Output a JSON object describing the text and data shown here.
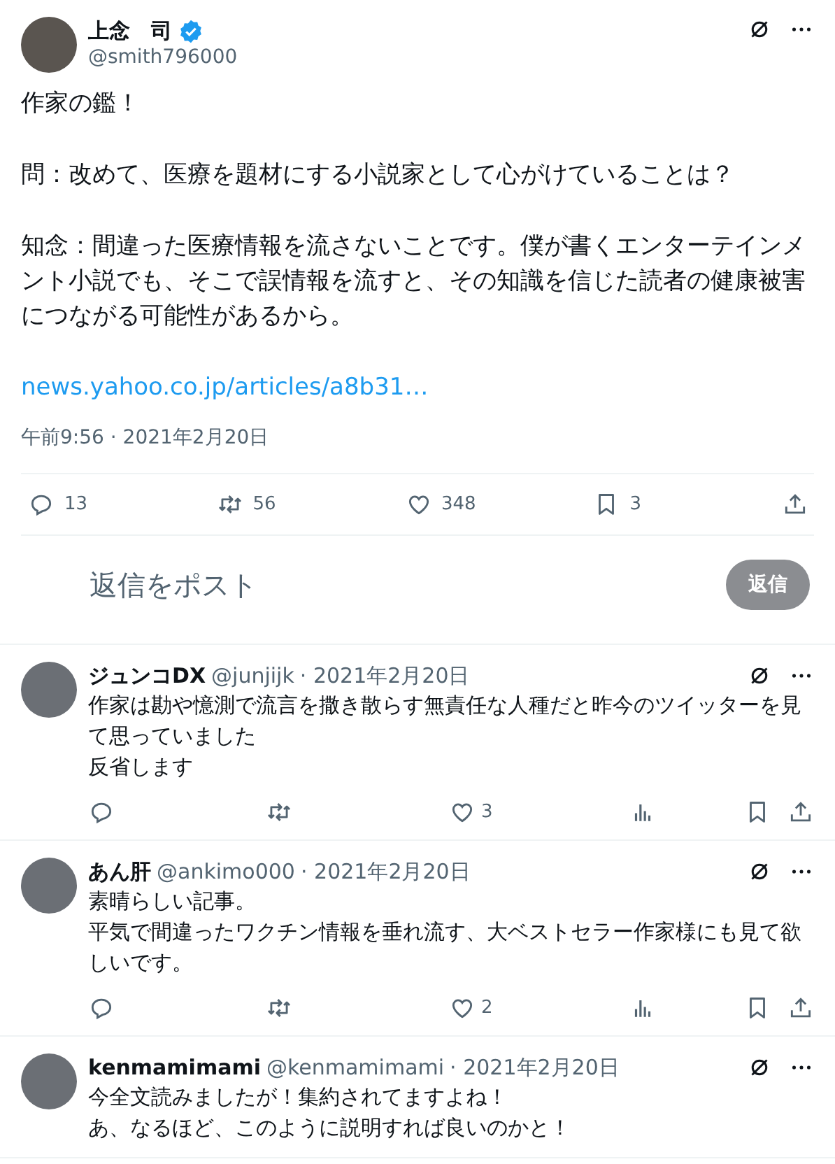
{
  "post": {
    "author": {
      "name": "上念　司",
      "handle": "@smith796000",
      "verified": true
    },
    "paragraphs": [
      "作家の鑑！",
      "問：改めて、医療を題材にする小説家として心がけていることは？",
      "知念：間違った医療情報を流さないことです。僕が書くエンターテインメント小説でも、そこで誤情報を流すと、その知識を信じた読者の健康被害につながる可能性があるから。"
    ],
    "link": "news.yahoo.co.jp/articles/a8b31…",
    "timestamp": "午前9:56 · 2021年2月20日",
    "stats": [
      {
        "kind": "reply",
        "count": "13"
      },
      {
        "kind": "repost",
        "count": "56"
      },
      {
        "kind": "like",
        "count": "348"
      },
      {
        "kind": "bookmark",
        "count": "3"
      },
      {
        "kind": "share"
      }
    ]
  },
  "reply_box": {
    "placeholder": "返信をポスト",
    "button": "返信"
  },
  "replies": [
    {
      "name": "ジュンコDX",
      "handle": "@junjijk",
      "date": "· 2021年2月20日",
      "lines": [
        "作家は勘や憶測で流言を撒き散らす無責任な人種だと昨今のツイッターを見て思っていました",
        "反省します"
      ],
      "actions": [
        {
          "kind": "reply"
        },
        {
          "kind": "repost"
        },
        {
          "kind": "like",
          "count": "3"
        },
        {
          "kind": "views"
        },
        {
          "kind": "bookmark"
        },
        {
          "kind": "share"
        }
      ]
    },
    {
      "name": "あん肝",
      "handle": "@ankimo000",
      "date": "· 2021年2月20日",
      "lines": [
        "素晴らしい記事。",
        "平気で間違ったワクチン情報を垂れ流す、大ベストセラー作家様にも見て欲しいです。"
      ],
      "actions": [
        {
          "kind": "reply"
        },
        {
          "kind": "repost"
        },
        {
          "kind": "like",
          "count": "2"
        },
        {
          "kind": "views"
        },
        {
          "kind": "bookmark"
        },
        {
          "kind": "share"
        }
      ]
    },
    {
      "name": "kenmamimami",
      "handle": "@kenmamimami",
      "date": "· 2021年2月20日",
      "lines": [
        "今全文読みましたが！集約されてますよね！",
        "あ、なるほど、このように説明すれば良いのかと！"
      ]
    }
  ]
}
